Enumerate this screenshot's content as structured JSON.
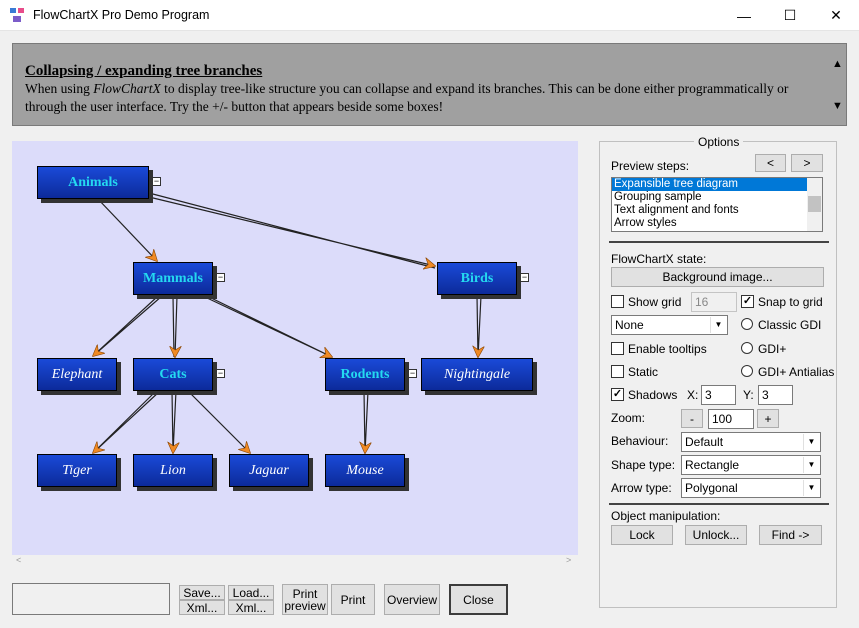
{
  "window": {
    "title": "FlowChartX Pro Demo Program",
    "minimize": "—",
    "maximize": "☐",
    "close": "✕"
  },
  "description": {
    "title": "Collapsing / expanding tree branches",
    "text_before": "When using ",
    "text_em": "FlowChartX",
    "text_after": " to display tree-like structure you can collapse and expand its branches. This can be done either programmatically or through the user interface. Try the +/- button that appears beside some boxes!",
    "scroll_up": "▲",
    "scroll_down": "▼"
  },
  "diagram": {
    "nodes": {
      "animals": "Animals",
      "mammals": "Mammals",
      "birds": "Birds",
      "elephant": "Elephant",
      "cats": "Cats",
      "rodents": "Rodents",
      "nightingale": "Nightingale",
      "tiger": "Tiger",
      "lion": "Lion",
      "jaguar": "Jaguar",
      "mouse": "Mouse"
    },
    "collapse_glyph": "−",
    "scroll_left": "<",
    "scroll_right": ">"
  },
  "buttons": {
    "save": "Save...",
    "save_xml": "Xml...",
    "load": "Load...",
    "load_xml": "Xml...",
    "print_preview": "Print preview",
    "print": "Print",
    "overview": "Overview",
    "close": "Close"
  },
  "options": {
    "legend": "Options",
    "preview_steps": "Preview steps:",
    "prev": "<",
    "next": ">",
    "steps": [
      "Expansible tree diagram",
      "Grouping sample",
      "Text alignment and fonts",
      "Arrow styles"
    ],
    "state_label": "FlowChartX state:",
    "background_image": "Background image...",
    "show_grid": "Show grid",
    "grid_size": "16",
    "snap_to_grid": "Snap to grid",
    "grid_style": "None",
    "classic_gdi": "Classic GDI",
    "enable_tooltips": "Enable tooltips",
    "gdi_plus": "GDI+",
    "static": "Static",
    "gdi_plus_antialias": "GDI+ Antialias",
    "shadows": "Shadows",
    "x_label": "X:",
    "x_value": "3",
    "y_label": "Y:",
    "y_value": "3",
    "zoom_label": "Zoom:",
    "zoom_minus": "-",
    "zoom_value": "100",
    "zoom_plus": "+",
    "behaviour_label": "Behaviour:",
    "behaviour_value": "Default",
    "shape_type_label": "Shape type:",
    "shape_type_value": "Rectangle",
    "arrow_type_label": "Arrow type:",
    "arrow_type_value": "Polygonal",
    "object_manipulation": "Object manipulation:",
    "lock": "Lock",
    "unlock": "Unlock...",
    "find": "Find ->",
    "checkmark": "✓",
    "dropdown_arrow": "▼"
  }
}
